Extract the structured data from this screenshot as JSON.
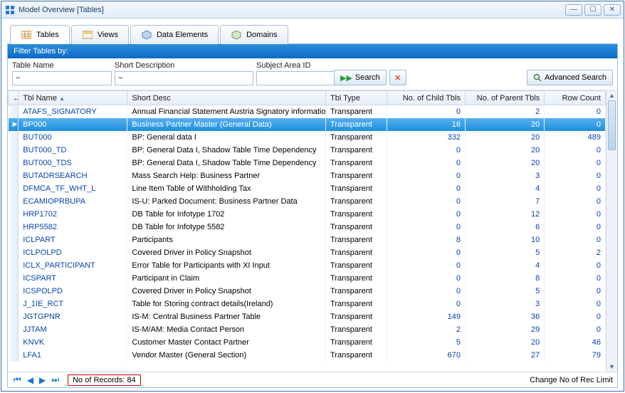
{
  "window": {
    "title": "Model Overview [Tables]"
  },
  "tabs": [
    {
      "label": "Tables",
      "active": true
    },
    {
      "label": "Views"
    },
    {
      "label": "Data Elements"
    },
    {
      "label": "Domains"
    }
  ],
  "filter": {
    "header": "Filter Tables by:",
    "table_name_label": "Table Name",
    "table_name_value": "~",
    "short_desc_label": "Short Description",
    "short_desc_value": "~",
    "subject_area_label": "Subject Area ID",
    "subject_area_value": "",
    "search_label": "Search",
    "advanced_label": "Advanced Search"
  },
  "columns": {
    "tbl_name": "Tbl Name",
    "short_desc": "Short Desc",
    "tbl_type": "Tbl Type",
    "child": "No. of Child Tbls",
    "parent": "No. of Parent Tbls",
    "rowcount": "Row Count"
  },
  "rows": [
    {
      "name": "ATAFS_SIGNATORY",
      "desc": "Annual Financial Statement Austria Signatory informatio",
      "type": "Transparent",
      "child": "0",
      "parent": "2",
      "rows": "0"
    },
    {
      "name": "BP000",
      "desc": "Business Partner Master (General Data)",
      "type": "Transparent",
      "child": "16",
      "parent": "20",
      "rows": "0",
      "selected": true
    },
    {
      "name": "BUT000",
      "desc": "BP: General data I",
      "type": "Transparent",
      "child": "332",
      "parent": "20",
      "rows": "489"
    },
    {
      "name": "BUT000_TD",
      "desc": "BP: General Data I, Shadow Table Time Dependency",
      "type": "Transparent",
      "child": "0",
      "parent": "20",
      "rows": "0"
    },
    {
      "name": "BUT000_TDS",
      "desc": "BP: General Data I, Shadow Table Time Dependency",
      "type": "Transparent",
      "child": "0",
      "parent": "20",
      "rows": "0"
    },
    {
      "name": "BUTADRSEARCH",
      "desc": "Mass Search Help: Business Partner",
      "type": "Transparent",
      "child": "0",
      "parent": "3",
      "rows": "0"
    },
    {
      "name": "DFMCA_TF_WHT_L",
      "desc": "Line Item Table of  Withholding Tax",
      "type": "Transparent",
      "child": "0",
      "parent": "4",
      "rows": "0"
    },
    {
      "name": "ECAMIOPRBUPA",
      "desc": "IS-U: Parked Document: Business Partner Data",
      "type": "Transparent",
      "child": "0",
      "parent": "7",
      "rows": "0"
    },
    {
      "name": "HRP1702",
      "desc": "DB Table for Infotype 1702",
      "type": "Transparent",
      "child": "0",
      "parent": "12",
      "rows": "0"
    },
    {
      "name": "HRP5582",
      "desc": "DB Table for Infotype 5582",
      "type": "Transparent",
      "child": "0",
      "parent": "6",
      "rows": "0"
    },
    {
      "name": "ICLPART",
      "desc": "Participants",
      "type": "Transparent",
      "child": "8",
      "parent": "10",
      "rows": "0"
    },
    {
      "name": "ICLPOLPD",
      "desc": "Covered Driver in Policy Snapshot",
      "type": "Transparent",
      "child": "0",
      "parent": "5",
      "rows": "2"
    },
    {
      "name": "ICLX_PARTICIPANT",
      "desc": "Error Table for Participants with XI Input",
      "type": "Transparent",
      "child": "0",
      "parent": "4",
      "rows": "0"
    },
    {
      "name": "ICSPART",
      "desc": "Participant in Claim",
      "type": "Transparent",
      "child": "0",
      "parent": "8",
      "rows": "0"
    },
    {
      "name": "ICSPOLPD",
      "desc": "Covered Driver in Policy Snapshot",
      "type": "Transparent",
      "child": "0",
      "parent": "5",
      "rows": "0"
    },
    {
      "name": "J_1IE_RCT",
      "desc": "Table for Storing contract details(Ireland)",
      "type": "Transparent",
      "child": "0",
      "parent": "3",
      "rows": "0"
    },
    {
      "name": "JGTGPNR",
      "desc": "IS-M: Central Business Partner Table",
      "type": "Transparent",
      "child": "149",
      "parent": "36",
      "rows": "0"
    },
    {
      "name": "JJTAM",
      "desc": "IS-M/AM: Media Contact Person",
      "type": "Transparent",
      "child": "2",
      "parent": "29",
      "rows": "0"
    },
    {
      "name": "KNVK",
      "desc": "Customer Master Contact Partner",
      "type": "Transparent",
      "child": "5",
      "parent": "20",
      "rows": "46"
    },
    {
      "name": "LFA1",
      "desc": "Vendor Master (General Section)",
      "type": "Transparent",
      "child": "670",
      "parent": "27",
      "rows": "79"
    }
  ],
  "footer": {
    "records_label": "No of Records: 84",
    "change_limit": "Change No of Rec Limit"
  }
}
